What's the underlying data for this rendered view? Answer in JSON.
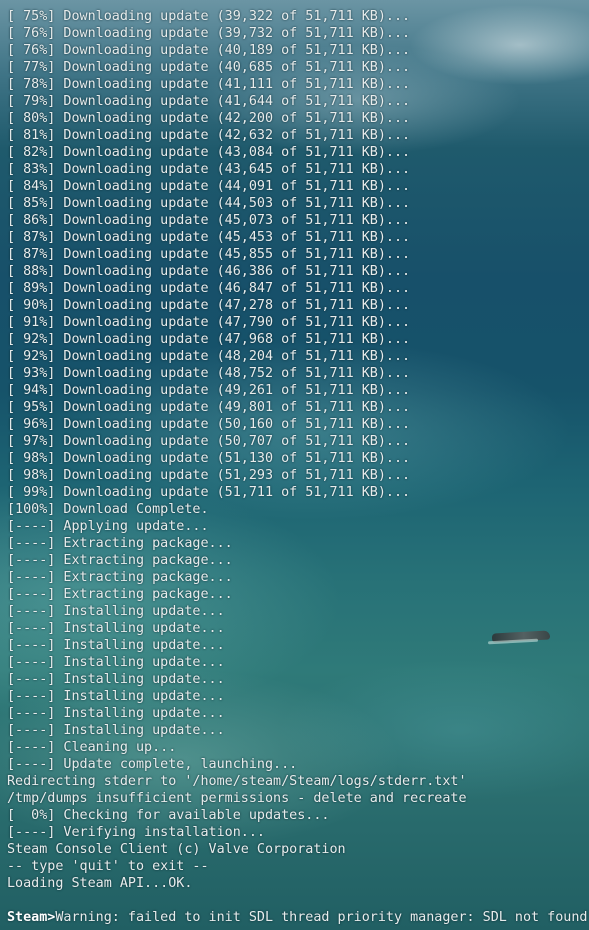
{
  "terminal": {
    "lines": [
      "[ 75%] Downloading update (39,322 of 51,711 KB)...",
      "[ 76%] Downloading update (39,732 of 51,711 KB)...",
      "[ 76%] Downloading update (40,189 of 51,711 KB)...",
      "[ 77%] Downloading update (40,685 of 51,711 KB)...",
      "[ 78%] Downloading update (41,111 of 51,711 KB)...",
      "[ 79%] Downloading update (41,644 of 51,711 KB)...",
      "[ 80%] Downloading update (42,200 of 51,711 KB)...",
      "[ 81%] Downloading update (42,632 of 51,711 KB)...",
      "[ 82%] Downloading update (43,084 of 51,711 KB)...",
      "[ 83%] Downloading update (43,645 of 51,711 KB)...",
      "[ 84%] Downloading update (44,091 of 51,711 KB)...",
      "[ 85%] Downloading update (44,503 of 51,711 KB)...",
      "[ 86%] Downloading update (45,073 of 51,711 KB)...",
      "[ 87%] Downloading update (45,453 of 51,711 KB)...",
      "[ 87%] Downloading update (45,855 of 51,711 KB)...",
      "[ 88%] Downloading update (46,386 of 51,711 KB)...",
      "[ 89%] Downloading update (46,847 of 51,711 KB)...",
      "[ 90%] Downloading update (47,278 of 51,711 KB)...",
      "[ 91%] Downloading update (47,790 of 51,711 KB)...",
      "[ 92%] Downloading update (47,968 of 51,711 KB)...",
      "[ 92%] Downloading update (48,204 of 51,711 KB)...",
      "[ 93%] Downloading update (48,752 of 51,711 KB)...",
      "[ 94%] Downloading update (49,261 of 51,711 KB)...",
      "[ 95%] Downloading update (49,801 of 51,711 KB)...",
      "[ 96%] Downloading update (50,160 of 51,711 KB)...",
      "[ 97%] Downloading update (50,707 of 51,711 KB)...",
      "[ 98%] Downloading update (51,130 of 51,711 KB)...",
      "[ 98%] Downloading update (51,293 of 51,711 KB)...",
      "[ 99%] Downloading update (51,711 of 51,711 KB)...",
      "[100%] Download Complete.",
      "[----] Applying update...",
      "[----] Extracting package...",
      "[----] Extracting package...",
      "[----] Extracting package...",
      "[----] Extracting package...",
      "[----] Installing update...",
      "[----] Installing update...",
      "[----] Installing update...",
      "[----] Installing update...",
      "[----] Installing update...",
      "[----] Installing update...",
      "[----] Installing update...",
      "[----] Installing update...",
      "[----] Cleaning up...",
      "[----] Update complete, launching...",
      "Redirecting stderr to '/home/steam/Steam/logs/stderr.txt'",
      "/tmp/dumps insufficient permissions - delete and recreate",
      "[  0%] Checking for available updates...",
      "[----] Verifying installation...",
      "Steam Console Client (c) Valve Corporation",
      "-- type 'quit' to exit --",
      "Loading Steam API...OK.",
      ""
    ],
    "prompt": "Steam>",
    "prompt_output": "Warning: failed to init SDL thread priority manager: SDL not found"
  }
}
